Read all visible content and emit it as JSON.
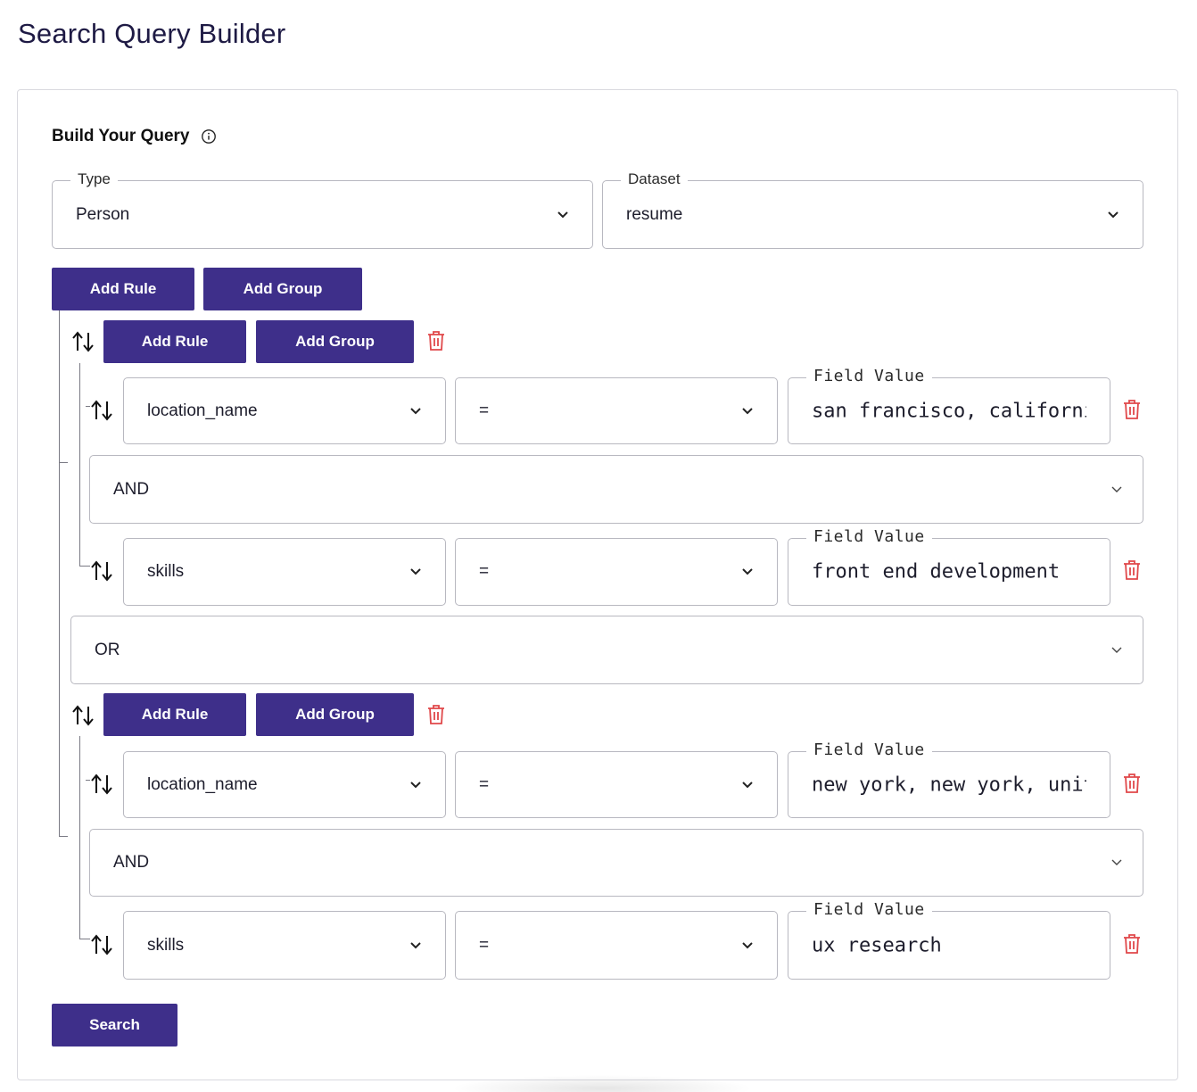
{
  "page": {
    "title": "Search Query Builder"
  },
  "builder": {
    "heading": "Build Your Query",
    "type": {
      "label": "Type",
      "value": "Person"
    },
    "dataset": {
      "label": "Dataset",
      "value": "resume"
    },
    "root": {
      "add_rule": "Add Rule",
      "add_group": "Add Group",
      "combinator": "OR"
    },
    "groups": [
      {
        "add_rule": "Add Rule",
        "add_group": "Add Group",
        "combinator": "AND",
        "rules": [
          {
            "field": "location_name",
            "operator": "=",
            "value_label": "Field Value",
            "value": "san francisco, california, united states"
          },
          {
            "field": "skills",
            "operator": "=",
            "value_label": "Field Value",
            "value": "front end development"
          }
        ]
      },
      {
        "add_rule": "Add Rule",
        "add_group": "Add Group",
        "combinator": "AND",
        "rules": [
          {
            "field": "location_name",
            "operator": "=",
            "value_label": "Field Value",
            "value": "new york, new york, united states"
          },
          {
            "field": "skills",
            "operator": "=",
            "value_label": "Field Value",
            "value": "ux research"
          }
        ]
      }
    ],
    "search_button": "Search"
  },
  "colors": {
    "primary": "#3e2f8a",
    "danger": "#e0484a",
    "border": "#b8b8c0",
    "title": "#1e1a44"
  },
  "icons": {
    "info": "info-icon",
    "chevron": "chevron-down-icon",
    "sort": "sort-arrows-icon",
    "delete": "trash-icon"
  }
}
